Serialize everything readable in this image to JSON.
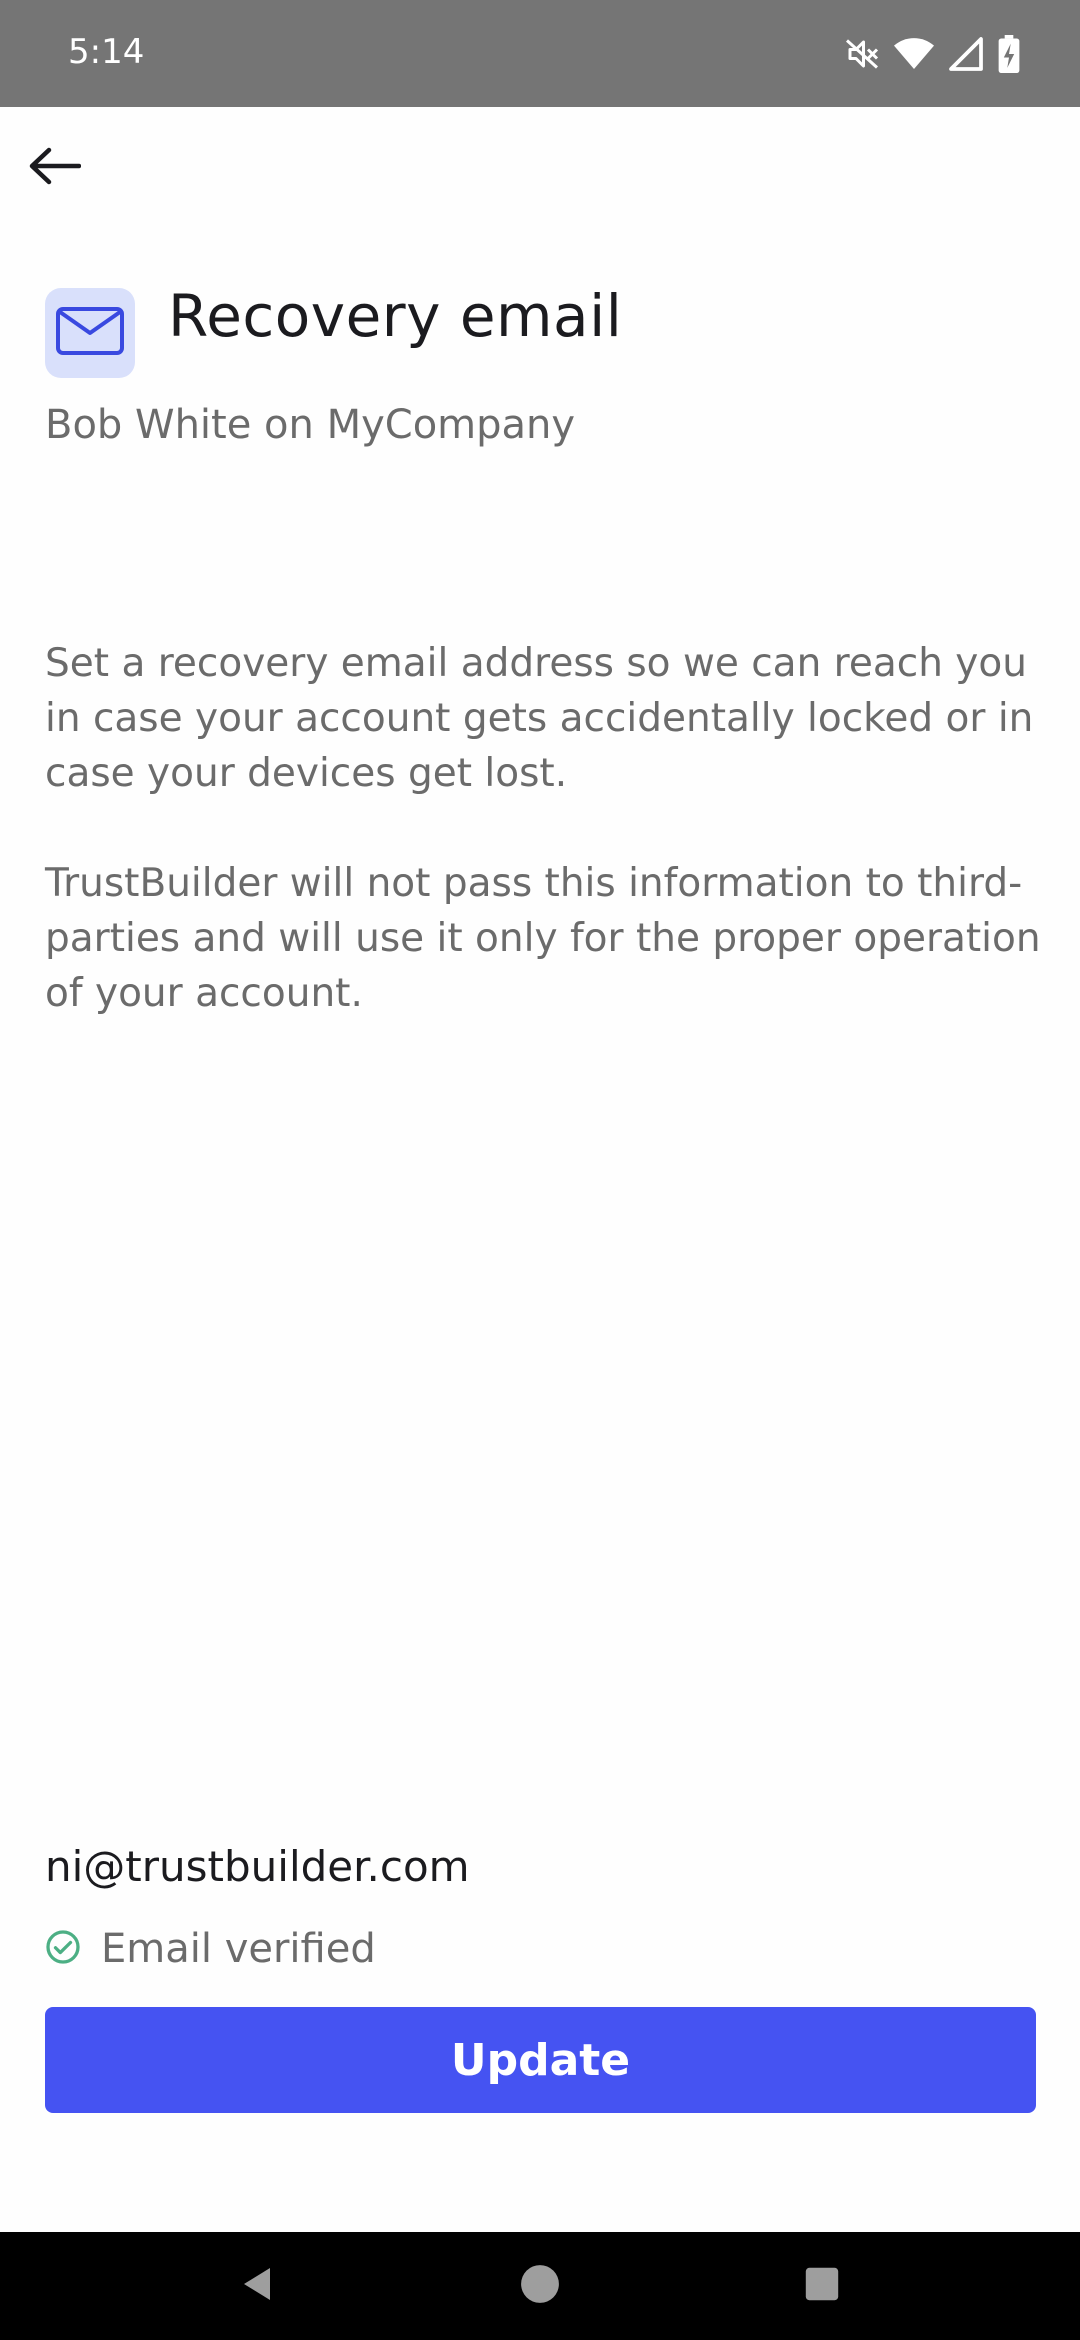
{
  "status_bar": {
    "time": "5:14",
    "icons": [
      "mute-icon",
      "wifi-icon",
      "signal-icon",
      "battery-charging-icon"
    ]
  },
  "app_bar": {
    "back_icon": "arrow-left-icon"
  },
  "header": {
    "icon": "mail-icon",
    "title": "Recovery email",
    "subtitle": "Bob White on MyCompany"
  },
  "description": {
    "paragraph_1": "Set a recovery email address so we can reach you in case your account gets accidentally locked or in case your devices get lost.",
    "paragraph_2": "TrustBuilder will not pass this information to third-parties and will use it only for the proper operation of your account."
  },
  "email": {
    "value": "ni@trustbuilder.com",
    "status_icon": "check-circle-icon",
    "status_text": "Email verified"
  },
  "actions": {
    "update_label": "Update"
  },
  "nav_bar": {
    "buttons": [
      "nav-back-icon",
      "nav-home-icon",
      "nav-recents-icon"
    ]
  },
  "colors": {
    "primary": "#4553f2",
    "icon_bg": "#d9e0fb",
    "verified": "#4caf84",
    "status_bar": "#757575"
  }
}
